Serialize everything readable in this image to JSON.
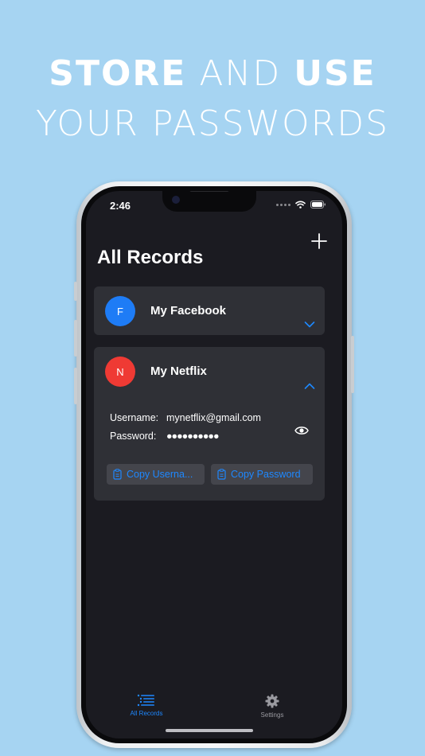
{
  "headline": {
    "line1_bold_a": "STORE",
    "line1_light": " AND ",
    "line1_bold_b": "USE",
    "line2": "YOUR PASSWORDS"
  },
  "status_bar": {
    "time": "2:46"
  },
  "page": {
    "title": "All Records"
  },
  "records": [
    {
      "initial": "F",
      "name": "My Facebook",
      "color": "#1e7cf6",
      "expanded": false
    },
    {
      "initial": "N",
      "name": "My Netflix",
      "color": "#ef3a34",
      "expanded": true,
      "username_label": "Username:",
      "username_value": "mynetflix@gmail.com",
      "password_label": "Password:",
      "password_value": "●●●●●●●●●●",
      "copy_username_label": "Copy Userna...",
      "copy_password_label": "Copy Password"
    }
  ],
  "tabs": [
    {
      "label": "All Records",
      "icon": "list-icon",
      "active": true
    },
    {
      "label": "Settings",
      "icon": "gear-icon",
      "active": false
    }
  ],
  "colors": {
    "accent": "#1e88ff",
    "background": "#a6d4f2",
    "screen": "#1b1b21",
    "card": "#2f3036"
  }
}
